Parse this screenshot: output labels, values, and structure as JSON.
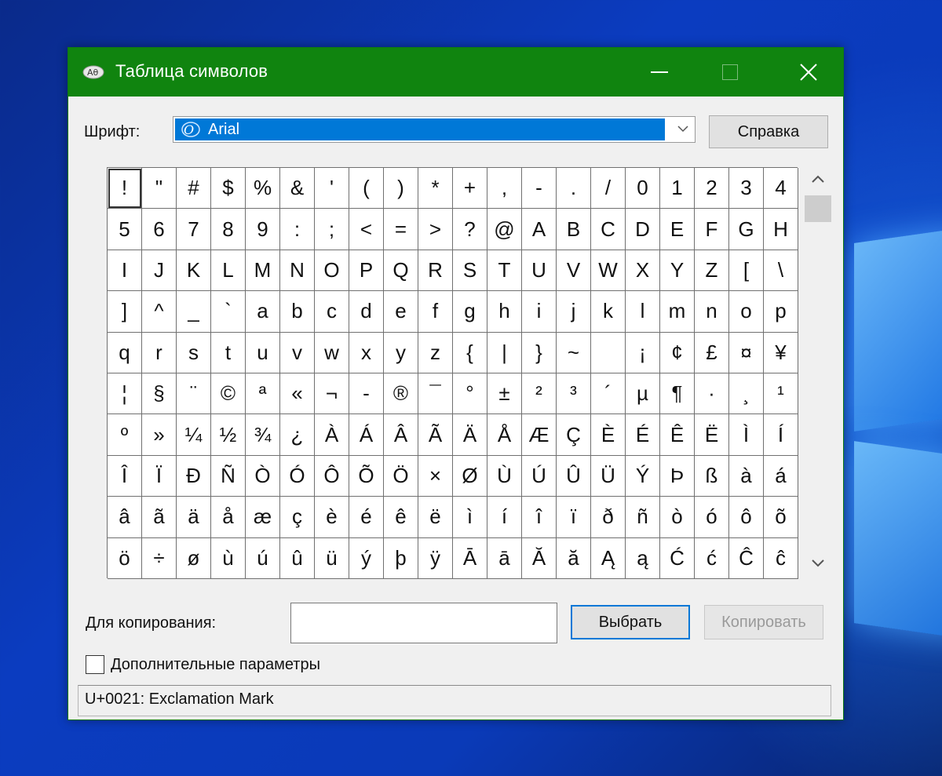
{
  "window": {
    "title": "Таблица символов"
  },
  "font": {
    "label": "Шрифт:",
    "selected": "Arial"
  },
  "help_button": "Справка",
  "grid": {
    "selected_index": 0,
    "rows": [
      [
        "!",
        "\"",
        "#",
        "$",
        "%",
        "&",
        "'",
        "(",
        ")",
        "*",
        "+",
        ",",
        "-",
        ".",
        "/",
        "0",
        "1",
        "2",
        "3",
        "4"
      ],
      [
        "5",
        "6",
        "7",
        "8",
        "9",
        ":",
        ";",
        "<",
        "=",
        ">",
        "?",
        "@",
        "A",
        "B",
        "C",
        "D",
        "E",
        "F",
        "G",
        "H"
      ],
      [
        "I",
        "J",
        "K",
        "L",
        "M",
        "N",
        "O",
        "P",
        "Q",
        "R",
        "S",
        "T",
        "U",
        "V",
        "W",
        "X",
        "Y",
        "Z",
        "[",
        "\\"
      ],
      [
        "]",
        "^",
        "_",
        "`",
        "a",
        "b",
        "c",
        "d",
        "e",
        "f",
        "g",
        "h",
        "i",
        "j",
        "k",
        "l",
        "m",
        "n",
        "o",
        "p"
      ],
      [
        "q",
        "r",
        "s",
        "t",
        "u",
        "v",
        "w",
        "x",
        "y",
        "z",
        "{",
        "|",
        "}",
        "~",
        " ",
        "¡",
        "¢",
        "£",
        "¤",
        "¥"
      ],
      [
        "¦",
        "§",
        "¨",
        "©",
        "ª",
        "«",
        "¬",
        "-",
        "®",
        "¯",
        "°",
        "±",
        "²",
        "³",
        "´",
        "µ",
        "¶",
        "·",
        "¸",
        "¹"
      ],
      [
        "º",
        "»",
        "¼",
        "½",
        "¾",
        "¿",
        "À",
        "Á",
        "Â",
        "Ã",
        "Ä",
        "Å",
        "Æ",
        "Ç",
        "È",
        "É",
        "Ê",
        "Ë",
        "Ì",
        "Í"
      ],
      [
        "Î",
        "Ï",
        "Ð",
        "Ñ",
        "Ò",
        "Ó",
        "Ô",
        "Õ",
        "Ö",
        "×",
        "Ø",
        "Ù",
        "Ú",
        "Û",
        "Ü",
        "Ý",
        "Þ",
        "ß",
        "à",
        "á"
      ],
      [
        "â",
        "ã",
        "ä",
        "å",
        "æ",
        "ç",
        "è",
        "é",
        "ê",
        "ë",
        "ì",
        "í",
        "î",
        "ï",
        "ð",
        "ñ",
        "ò",
        "ó",
        "ô",
        "õ"
      ],
      [
        "ö",
        "÷",
        "ø",
        "ù",
        "ú",
        "û",
        "ü",
        "ý",
        "þ",
        "ÿ",
        "Ā",
        "ā",
        "Ă",
        "ă",
        "Ą",
        "ą",
        "Ć",
        "ć",
        "Ĉ",
        "ĉ"
      ]
    ]
  },
  "copy": {
    "label": "Для копирования:",
    "value": "",
    "select_button": "Выбрать",
    "copy_button": "Копировать"
  },
  "advanced": {
    "label": "Дополнительные параметры",
    "checked": false
  },
  "status": "U+0021: Exclamation Mark",
  "colors": {
    "titlebar": "#10840f",
    "selection": "#0078d7"
  },
  "icons": [
    "app-icon",
    "minimize-icon",
    "maximize-icon",
    "close-icon",
    "font-type-icon",
    "chevron-down-icon",
    "scroll-up-icon",
    "scroll-down-icon"
  ]
}
